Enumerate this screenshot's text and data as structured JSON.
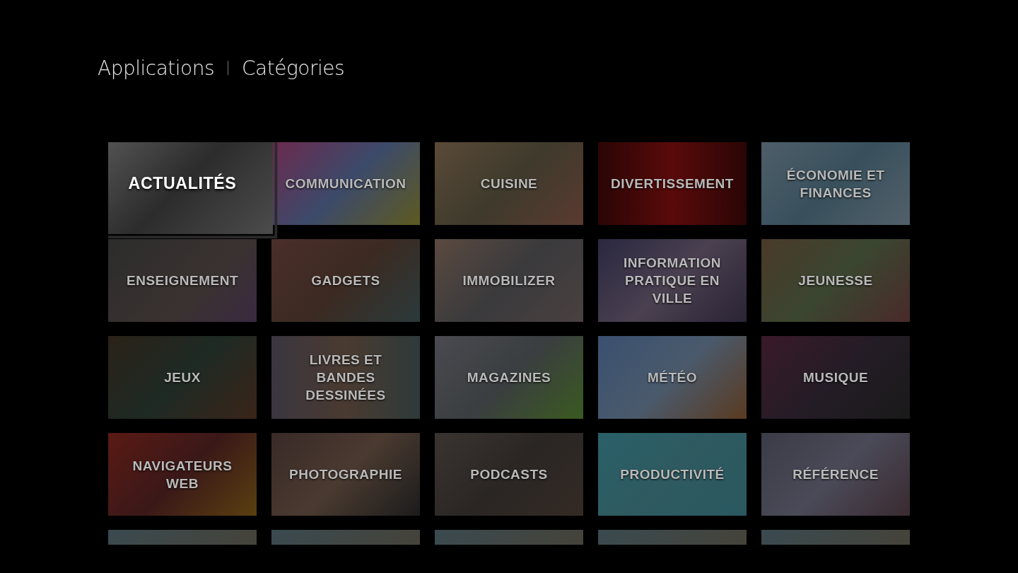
{
  "breadcrumb": [
    "Applications",
    "Catégories"
  ],
  "tiles": [
    {
      "label": "ACTUALITÉS",
      "selected": true
    },
    {
      "label": "COMMUNICATION",
      "selected": false
    },
    {
      "label": "CUISINE",
      "selected": false
    },
    {
      "label": "DIVERTISSEMENT",
      "selected": false
    },
    {
      "label": "ÉCONOMIE ET FINANCES",
      "selected": false
    },
    {
      "label": "ENSEIGNEMENT",
      "selected": false
    },
    {
      "label": "GADGETS",
      "selected": false
    },
    {
      "label": "IMMOBILIZER",
      "selected": false
    },
    {
      "label": "INFORMATION PRATIQUE EN VILLE",
      "selected": false
    },
    {
      "label": "JEUNESSE",
      "selected": false
    },
    {
      "label": "JEUX",
      "selected": false
    },
    {
      "label": "LIVRES ET BANDES DESSINÉES",
      "selected": false
    },
    {
      "label": "MAGAZINES",
      "selected": false
    },
    {
      "label": "MÉTÉO",
      "selected": false
    },
    {
      "label": "MUSIQUE",
      "selected": false
    },
    {
      "label": "NAVIGATEURS WEB",
      "selected": false
    },
    {
      "label": "PHOTOGRAPHIE",
      "selected": false
    },
    {
      "label": "PODCASTS",
      "selected": false
    },
    {
      "label": "PRODUCTIVITÉ",
      "selected": false
    },
    {
      "label": "RÉFÉRENCE",
      "selected": false
    },
    {
      "selected": false
    },
    {
      "selected": false
    },
    {
      "selected": false
    },
    {
      "selected": false
    },
    {
      "selected": false
    }
  ]
}
